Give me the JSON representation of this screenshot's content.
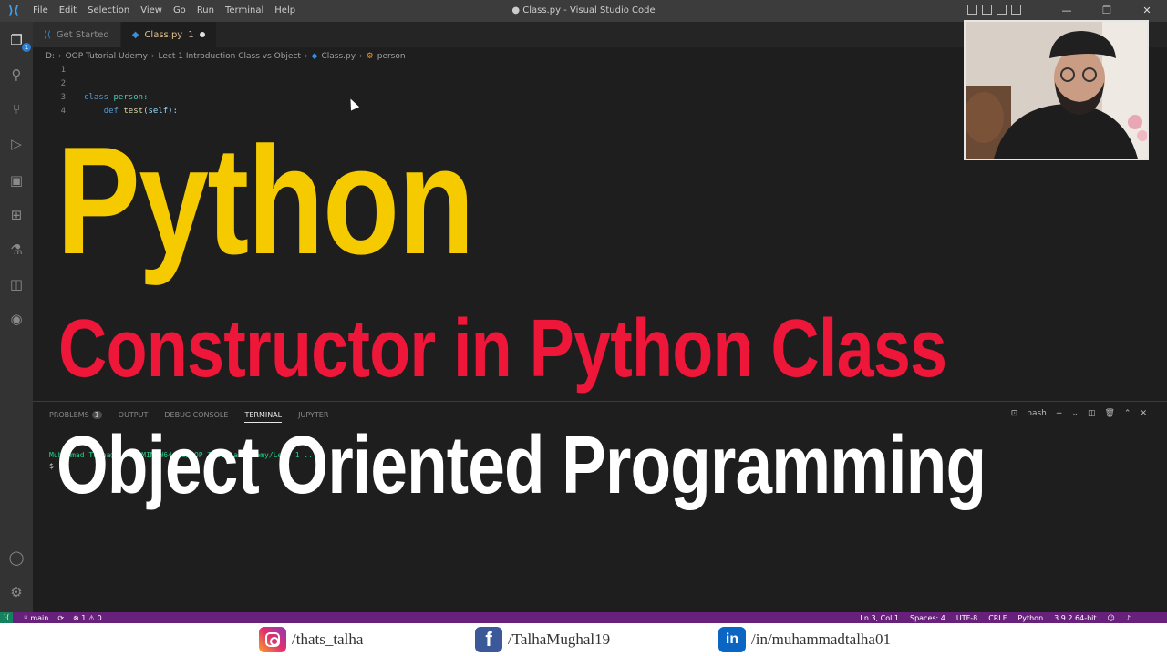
{
  "titlebar": {
    "menu": [
      "File",
      "Edit",
      "Selection",
      "View",
      "Go",
      "Run",
      "Terminal",
      "Help"
    ],
    "title": "● Class.py - Visual Studio Code"
  },
  "activitybar": {
    "badge": "1"
  },
  "tabs": [
    {
      "label": "Get Started",
      "active": false
    },
    {
      "label": "Class.py",
      "modified_count": "1",
      "active": true
    }
  ],
  "breadcrumb": [
    "D:",
    "OOP Tutorial Udemy",
    "Lect 1 Introduction Class vs Object",
    "Class.py",
    "person"
  ],
  "editor": {
    "line_numbers": [
      "1",
      "2",
      "3",
      "4"
    ],
    "line3": {
      "keyword": "class",
      "name": "person:"
    },
    "line4": {
      "keyword": "def",
      "func": "test",
      "params": "(self):"
    }
  },
  "panel": {
    "tabs": {
      "problems": "PROBLEMS",
      "problems_count": "1",
      "output": "OUTPUT",
      "debug": "DEBUG CONSOLE",
      "terminal": "TERMINAL",
      "jupyter": "JUPYTER"
    },
    "shell": "bash",
    "term_line1": "Muhammad Talha@ ...  MINGW64 /d/OOP Tutorial Udemy/Lect 1 ...",
    "term_prompt": "$"
  },
  "statusbar": {
    "branch": "main",
    "problems": "⊗ 1 ⚠ 0",
    "position": "Ln 3, Col 1",
    "spaces": "Spaces: 4",
    "encoding": "UTF-8",
    "eol": "CRLF",
    "language": "Python",
    "interpreter": "3.9.2 64-bit"
  },
  "overlay": {
    "line1": "Python",
    "line2": "Constructor in Python Class",
    "line3": "Object Oriented Programming"
  },
  "social": {
    "instagram": "/thats_talha",
    "facebook": "/TalhaMughal19",
    "linkedin": "/in/muhammadtalha01"
  },
  "colors": {
    "yellow_title": "#f5cb00",
    "red_title": "#ee1639",
    "statusbar": "#68217a"
  }
}
